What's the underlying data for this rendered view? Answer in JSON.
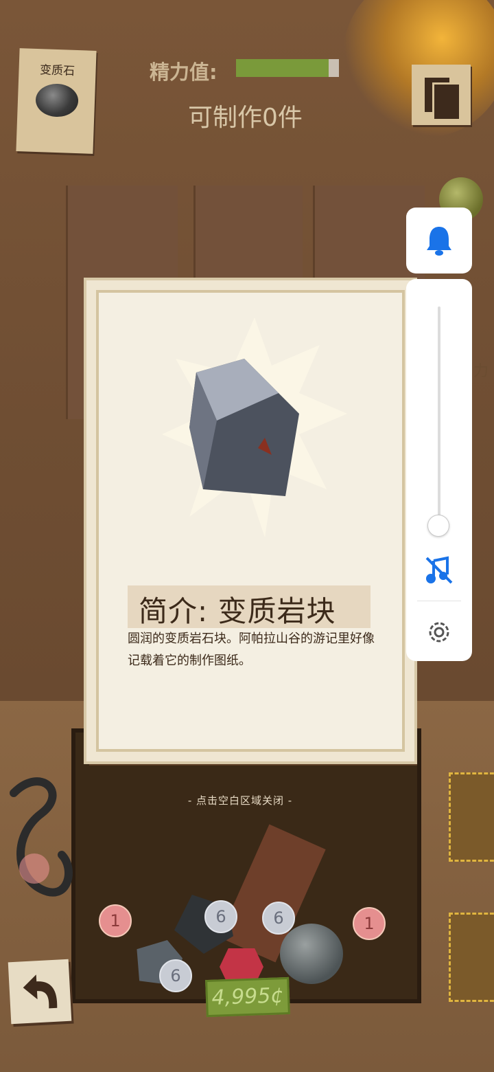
{
  "top_item_card": {
    "label": "变质石"
  },
  "energy": {
    "label": "精力值:",
    "level": 0.9
  },
  "craft": {
    "count_text": "可制作0件"
  },
  "info_card": {
    "title": "简介: 变质岩块",
    "description": "圆润的变质岩石块。阿帕拉山谷的游记里好像记载着它的制作图纸。"
  },
  "close_hint": "- 点击空白区域关闭 -",
  "inventory": {
    "badges": [
      "1",
      "6",
      "6",
      "6",
      "1"
    ],
    "money": "4,995¢"
  },
  "edge_text": "力",
  "system_volume": {
    "accent_color": "#1a73e8",
    "icons": [
      "bell-icon",
      "music-off-icon",
      "gear-icon"
    ],
    "level": 0.05
  }
}
